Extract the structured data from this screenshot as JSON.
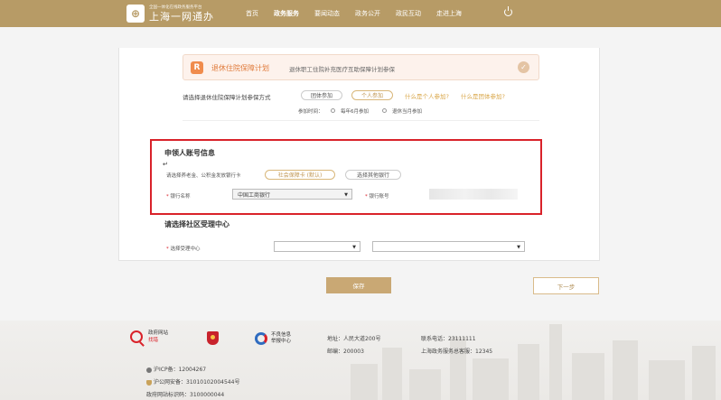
{
  "header": {
    "logo_subtitle": "全国一体化在线政务服务平台",
    "logo_title": "上海一网通办",
    "nav": [
      "首页",
      "政务服务",
      "要闻动态",
      "政务公开",
      "政民互动",
      "走进上海"
    ],
    "active_nav_index": 1
  },
  "plan": {
    "icon_letter": "R",
    "title": "退休住院保障计划",
    "description": "退休职工住院补充医疗互助保障计划参保"
  },
  "participation": {
    "label": "请选择退休住院保障计划参保方式",
    "options": [
      "团体参加",
      "个人参加"
    ],
    "selected_option": "个人参加",
    "help_link_1": "什么是个人参加?",
    "help_link_2": "什么是团体参加?",
    "time_label": "参加时间：",
    "time_options": [
      "每年6月参加",
      "退休当月参加"
    ]
  },
  "account": {
    "title": "申领人账号信息",
    "enter_mark": "↵",
    "card_label": "请选择养老金、公积金发放银行卡",
    "card_options": [
      "社会保障卡 (默认)",
      "选择其他银行"
    ],
    "selected_card": "社会保障卡 (默认)",
    "bank_name_label": "银行名称",
    "bank_name_value": "中国工商银行",
    "bank_account_label": "银行账号",
    "required_mark": "*"
  },
  "center": {
    "title": "请选择社区受理中心",
    "label": "选择受理中心",
    "select1_value": "",
    "select2_value": ""
  },
  "buttons": {
    "save": "保存",
    "next": "下一步"
  },
  "footer": {
    "gov_site_line1": "政府网站",
    "gov_site_line2": "找错",
    "report_line1": "不良信息",
    "report_line2": "举报中心",
    "address": "地址：人民大道200号",
    "postcode": "邮编：200003",
    "phone": "联系电话：23111111",
    "hotline": "上海政务服务总客服：12345",
    "icp": "沪ICP备：12004267",
    "police": "沪公网安备：31010102004544号",
    "gov_id": "政府网站标识码：3100000044"
  },
  "colors": {
    "header_bg": "#b79b66",
    "accent": "#c9a874",
    "highlight_border": "#d9222a",
    "plan_orange": "#e07a3a"
  }
}
